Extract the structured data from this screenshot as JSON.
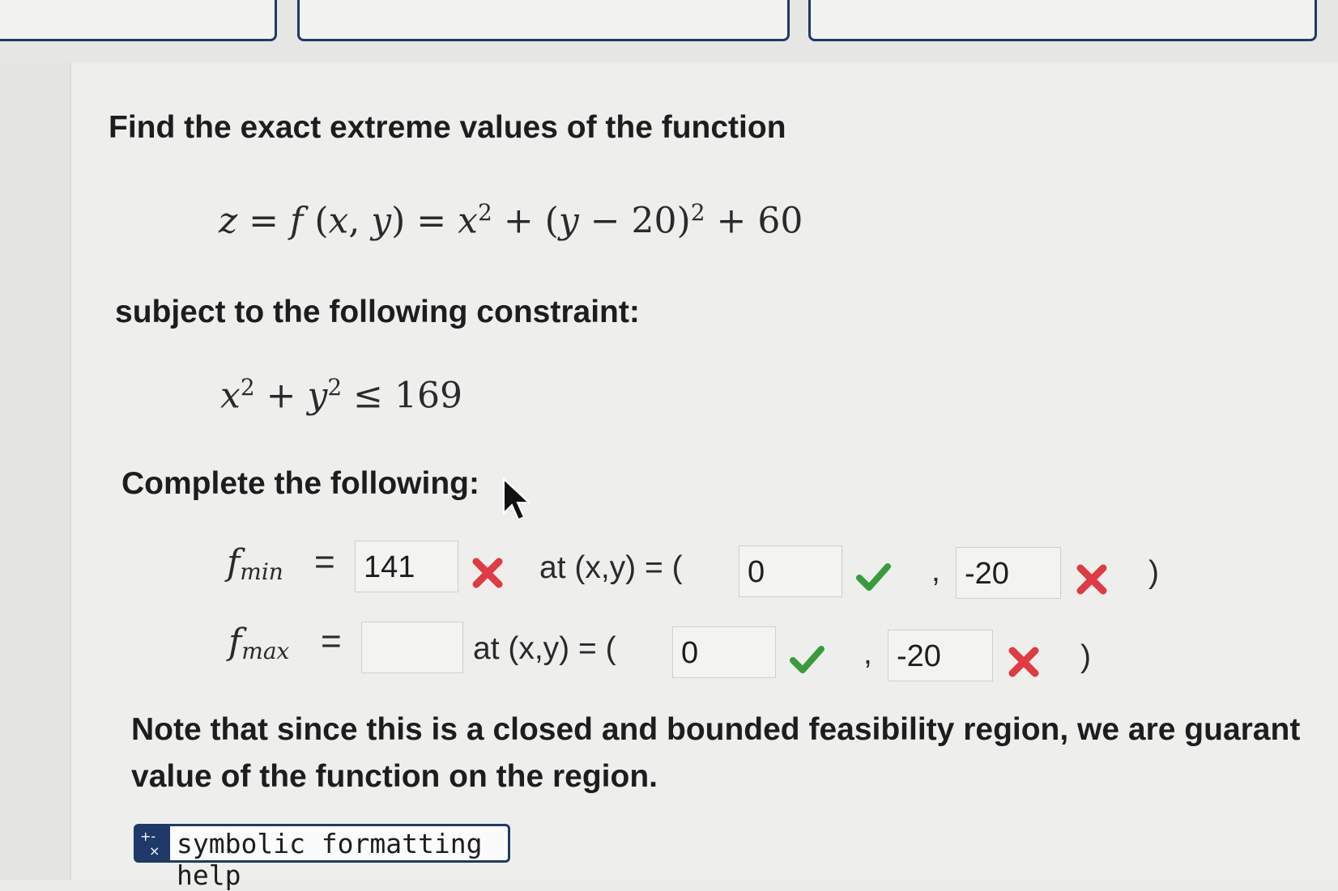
{
  "question": {
    "intro": "Find the exact extreme values of the function",
    "constraint_intro": "subject to the following constraint:",
    "complete_label": "Complete the following:",
    "note_line1": "Note that since this is a closed and bounded feasibility region, we are guarant",
    "note_line2": "value of the function on the region."
  },
  "answers": {
    "at_label": "at (x,y) = (",
    "comma": ",",
    "close_paren": ")",
    "fmin": {
      "value": "141",
      "x": "0",
      "y": "-20",
      "value_status": "incorrect",
      "x_status": "correct",
      "y_status": "incorrect"
    },
    "fmax": {
      "value": "",
      "x": "0",
      "y": "-20",
      "x_status": "correct",
      "y_status": "incorrect"
    }
  },
  "help": {
    "label": "symbolic formatting help"
  },
  "colors": {
    "accent": "#1f3a68",
    "correct": "#3a9b3c",
    "incorrect": "#e03a42"
  },
  "icons": [
    "cursor-arrow-icon",
    "check-icon",
    "cross-icon",
    "symbolic-help-icon"
  ]
}
